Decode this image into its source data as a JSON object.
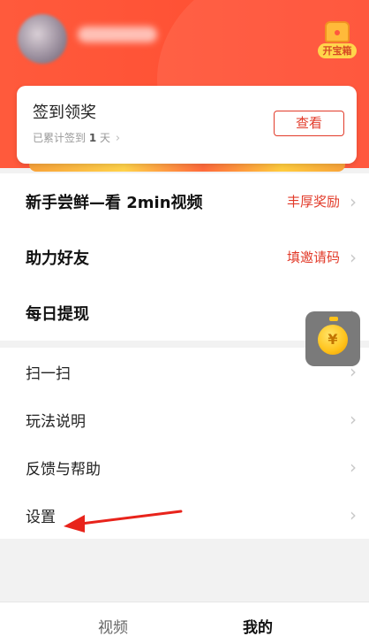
{
  "header": {
    "treasure_label": "开宝箱"
  },
  "signin": {
    "title": "签到领奖",
    "streak_prefix": "已累计签到",
    "streak_count": "1",
    "streak_unit": "天",
    "button": "查看"
  },
  "tasks": [
    {
      "label": "新手尝鲜—看 2min视频",
      "right": "丰厚奖励"
    },
    {
      "label": "助力好友",
      "right": "填邀请码"
    },
    {
      "label": "每日提现",
      "right": ""
    }
  ],
  "menu": [
    {
      "label": "扫一扫"
    },
    {
      "label": "玩法说明"
    },
    {
      "label": "反馈与帮助"
    },
    {
      "label": "设置"
    }
  ],
  "coin_symbol": "¥",
  "chevron": "›",
  "tabs": {
    "video": "视频",
    "mine": "我的"
  },
  "colors": {
    "header_red": "#ff4a2e",
    "accent_red": "#e23b2a",
    "coin_gold": "#ffc21a"
  }
}
